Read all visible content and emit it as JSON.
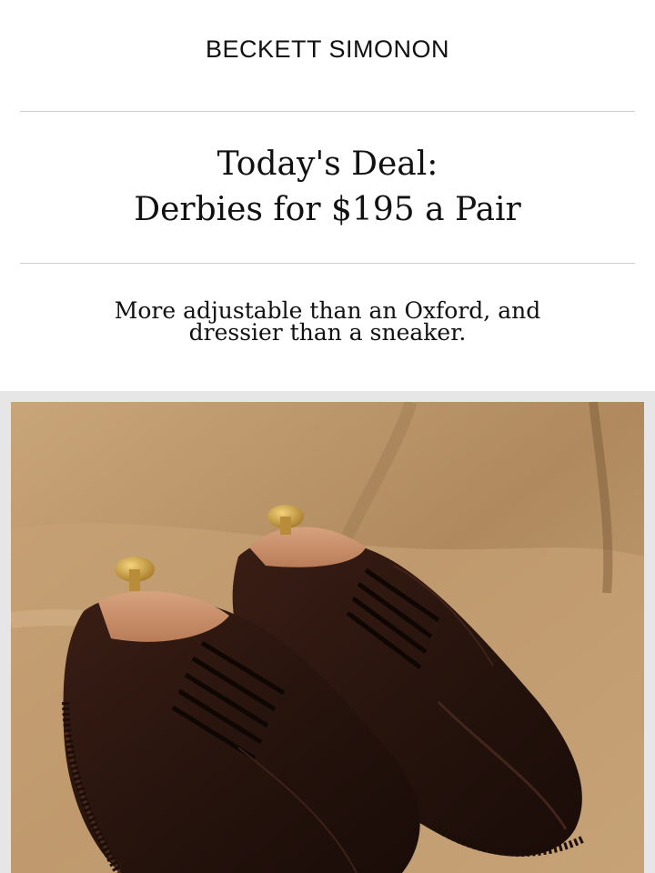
{
  "brand": {
    "name": "BECKETT SIMONON"
  },
  "headline": {
    "line1": "Today's Deal:",
    "line2": "Derbies for $195 a Pair"
  },
  "subhead": {
    "line1": "More adjustable than an Oxford, and",
    "line2": "dressier than a sneaker."
  },
  "hero_image": {
    "subject": "Two dark brown leather derby shoes with wooden shoe trees on a velvet chair",
    "background_color": "#b8946a",
    "leather_color": "#2b1610"
  }
}
